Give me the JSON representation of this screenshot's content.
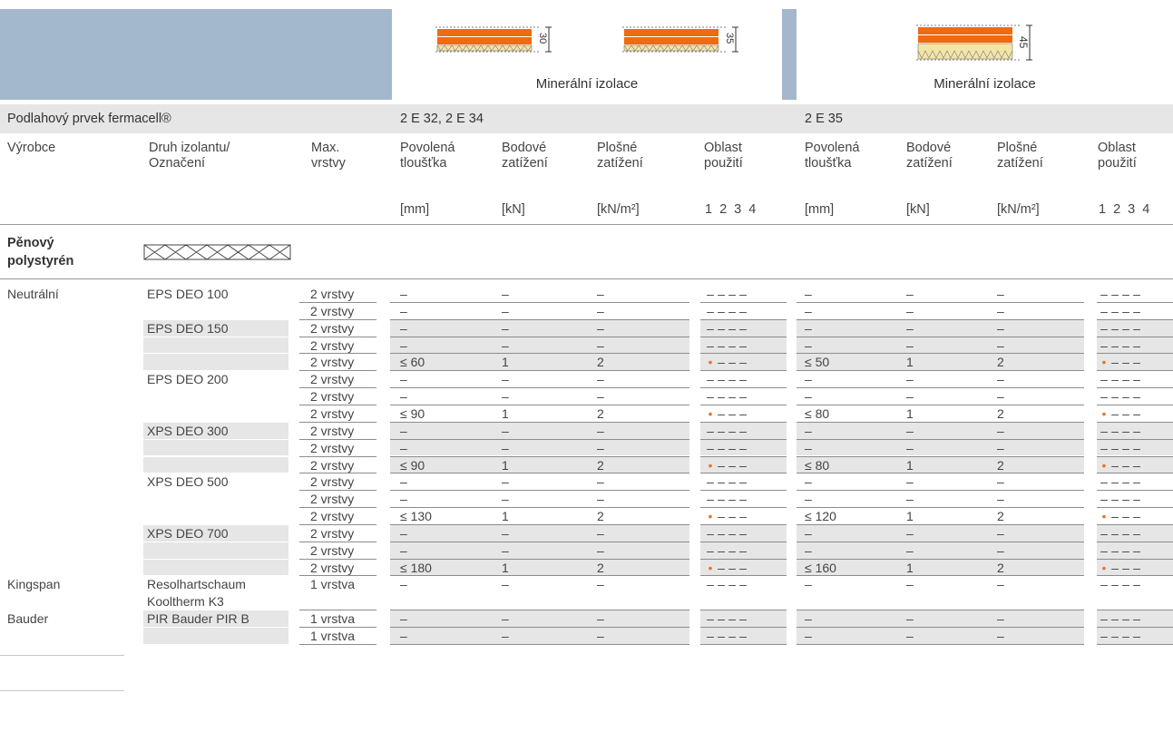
{
  "header": {
    "panel1_caption": "Minerální izolace",
    "panel2_caption": "Minerální izolace",
    "dims": [
      "30",
      "35",
      "45"
    ]
  },
  "section": {
    "title": "Podlahový prvek fermacell®",
    "group1": "2 E 32, 2 E 34",
    "group2": "2 E 35"
  },
  "columns": {
    "vyrobce": "Výrobce",
    "druh1": "Druh izolantu/",
    "druh2": "Označení",
    "max1": "Max.",
    "max2": "vrstvy",
    "tl1": "Povolená",
    "tl2": "tloušťka",
    "bod1": "Bodové",
    "bod2": "zatížení",
    "plo1": "Plošné",
    "plo2": "zatížení",
    "obl1": "Oblast",
    "obl2": "použití",
    "unit_mm": "[mm]",
    "unit_kn": "[kN]",
    "unit_knm2": "[kN/m²]",
    "unit_area": "1 2 3 4"
  },
  "category": {
    "line1": "Pěnový",
    "line2": "polystyrén"
  },
  "colors": {
    "header_bg": "#a3b7cd",
    "gray_row": "#e6e6e6",
    "accent": "#e8772e"
  },
  "rows": [
    {
      "maker": "Neutrální",
      "type": "EPS DEO 100",
      "layers": "2 vrstvy",
      "g": false,
      "t1": "–",
      "b1": "–",
      "p1": "–",
      "dot1": false,
      "t2": "–",
      "b2": "–",
      "p2": "–",
      "dot2": false
    },
    {
      "maker": "",
      "type": "",
      "layers": "2 vrstvy",
      "g": false,
      "t1": "–",
      "b1": "–",
      "p1": "–",
      "dot1": false,
      "t2": "–",
      "b2": "–",
      "p2": "–",
      "dot2": false
    },
    {
      "maker": "",
      "type": "EPS DEO 150",
      "layers": "2 vrstvy",
      "g": true,
      "t1": "–",
      "b1": "–",
      "p1": "–",
      "dot1": false,
      "t2": "–",
      "b2": "–",
      "p2": "–",
      "dot2": false
    },
    {
      "maker": "",
      "type": "",
      "layers": "2 vrstvy",
      "g": true,
      "t1": "–",
      "b1": "–",
      "p1": "–",
      "dot1": false,
      "t2": "–",
      "b2": "–",
      "p2": "–",
      "dot2": false
    },
    {
      "maker": "",
      "type": "",
      "layers": "2 vrstvy",
      "g": true,
      "t1": "≤ 60",
      "b1": "1",
      "p1": "2",
      "dot1": true,
      "t2": "≤ 50",
      "b2": "1",
      "p2": "2",
      "dot2": true
    },
    {
      "maker": "",
      "type": "EPS DEO 200",
      "layers": "2 vrstvy",
      "g": false,
      "t1": "–",
      "b1": "–",
      "p1": "–",
      "dot1": false,
      "t2": "–",
      "b2": "–",
      "p2": "–",
      "dot2": false
    },
    {
      "maker": "",
      "type": "",
      "layers": "2 vrstvy",
      "g": false,
      "t1": "–",
      "b1": "–",
      "p1": "–",
      "dot1": false,
      "t2": "–",
      "b2": "–",
      "p2": "–",
      "dot2": false
    },
    {
      "maker": "",
      "type": "",
      "layers": "2 vrstvy",
      "g": false,
      "t1": "≤ 90",
      "b1": "1",
      "p1": "2",
      "dot1": true,
      "t2": "≤ 80",
      "b2": "1",
      "p2": "2",
      "dot2": true
    },
    {
      "maker": "",
      "type": "XPS DEO 300",
      "layers": "2 vrstvy",
      "g": true,
      "t1": "–",
      "b1": "–",
      "p1": "–",
      "dot1": false,
      "t2": "–",
      "b2": "–",
      "p2": "–",
      "dot2": false
    },
    {
      "maker": "",
      "type": "",
      "layers": "2 vrstvy",
      "g": true,
      "t1": "–",
      "b1": "–",
      "p1": "–",
      "dot1": false,
      "t2": "–",
      "b2": "–",
      "p2": "–",
      "dot2": false
    },
    {
      "maker": "",
      "type": "",
      "layers": "2 vrstvy",
      "g": true,
      "t1": "≤ 90",
      "b1": "1",
      "p1": "2",
      "dot1": true,
      "t2": "≤ 80",
      "b2": "1",
      "p2": "2",
      "dot2": true
    },
    {
      "maker": "",
      "type": "XPS DEO 500",
      "layers": "2 vrstvy",
      "g": false,
      "t1": "–",
      "b1": "–",
      "p1": "–",
      "dot1": false,
      "t2": "–",
      "b2": "–",
      "p2": "–",
      "dot2": false
    },
    {
      "maker": "",
      "type": "",
      "layers": "2 vrstvy",
      "g": false,
      "t1": "–",
      "b1": "–",
      "p1": "–",
      "dot1": false,
      "t2": "–",
      "b2": "–",
      "p2": "–",
      "dot2": false
    },
    {
      "maker": "",
      "type": "",
      "layers": "2 vrstvy",
      "g": false,
      "t1": "≤ 130",
      "b1": "1",
      "p1": "2",
      "dot1": true,
      "t2": "≤ 120",
      "b2": "1",
      "p2": "2",
      "dot2": true
    },
    {
      "maker": "",
      "type": "XPS DEO 700",
      "layers": "2 vrstvy",
      "g": true,
      "t1": "–",
      "b1": "–",
      "p1": "–",
      "dot1": false,
      "t2": "–",
      "b2": "–",
      "p2": "–",
      "dot2": false
    },
    {
      "maker": "",
      "type": "",
      "layers": "2 vrstvy",
      "g": true,
      "t1": "–",
      "b1": "–",
      "p1": "–",
      "dot1": false,
      "t2": "–",
      "b2": "–",
      "p2": "–",
      "dot2": false
    },
    {
      "maker": "",
      "type": "",
      "layers": "2 vrstvy",
      "g": true,
      "t1": "≤ 180",
      "b1": "1",
      "p1": "2",
      "dot1": true,
      "t2": "≤ 160",
      "b2": "1",
      "p2": "2",
      "dot2": true
    },
    {
      "maker": "Kingspan",
      "type": "Resolhartschaum",
      "type2": "Kooltherm K3",
      "layers": "1 vrstva",
      "g": false,
      "tall": true,
      "t1": "–",
      "b1": "–",
      "p1": "–",
      "dot1": false,
      "t2": "–",
      "b2": "–",
      "p2": "–",
      "dot2": false
    },
    {
      "maker": "Bauder",
      "type": "PIR Bauder PIR B",
      "layers": "1 vrstva",
      "g": true,
      "t1": "–",
      "b1": "–",
      "p1": "–",
      "dot1": false,
      "t2": "–",
      "b2": "–",
      "p2": "–",
      "dot2": false
    },
    {
      "maker": "",
      "type": "",
      "layers": "1 vrstva",
      "g": true,
      "t1": "–",
      "b1": "–",
      "p1": "–",
      "dot1": false,
      "t2": "–",
      "b2": "–",
      "p2": "–",
      "dot2": false
    }
  ]
}
